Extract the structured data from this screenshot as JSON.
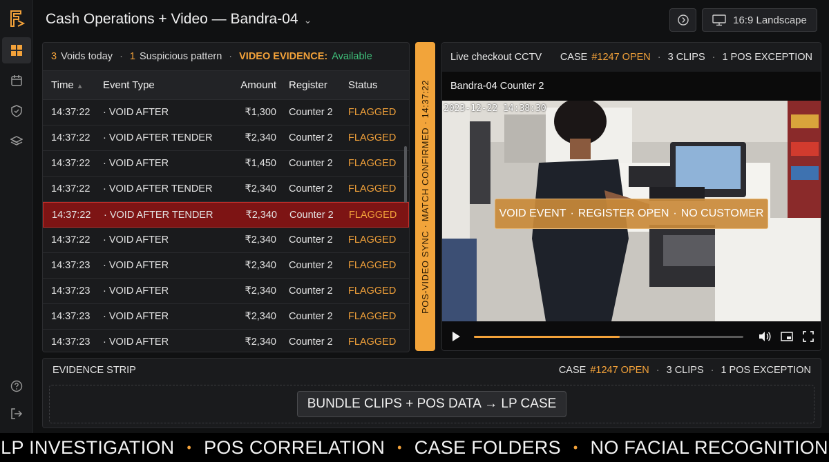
{
  "header": {
    "title": "Cash Operations + Video — Bandra-04",
    "layout_label": "16:9 Landscape"
  },
  "summary": {
    "voids_count": "3",
    "voids_label": "Voids today",
    "suspicious_count": "1",
    "suspicious_label": "Suspicious pattern",
    "video_label": "VIDEO EVIDENCE:",
    "video_status": "Available"
  },
  "table": {
    "columns": [
      "Time",
      "Event Type",
      "Amount",
      "Register",
      "Status"
    ],
    "rows": [
      {
        "time": "14:37:22",
        "type": "VOID AFTER",
        "amount": "₹1,300",
        "register": "Counter 2",
        "status": "FLAGGED"
      },
      {
        "time": "14:37:22",
        "type": "VOID AFTER TENDER",
        "amount": "₹2,340",
        "register": "Counter 2",
        "status": "FLAGGED"
      },
      {
        "time": "14:37:22",
        "type": "VOID AFTER",
        "amount": "₹1,450",
        "register": "Counter 2",
        "status": "FLAGGED"
      },
      {
        "time": "14:37:22",
        "type": "VOID AFTER TENDER",
        "amount": "₹2,340",
        "register": "Counter 2",
        "status": "FLAGGED"
      },
      {
        "time": "14:37:22",
        "type": "VOID AFTER TENDER",
        "amount": "₹2,340",
        "register": "Counter 2",
        "status": "FLAGGED",
        "selected": true
      },
      {
        "time": "14:37:22",
        "type": "VOID AFTER",
        "amount": "₹2,340",
        "register": "Counter 2",
        "status": "FLAGGED"
      },
      {
        "time": "14:37:23",
        "type": "VOID AFTER",
        "amount": "₹2,340",
        "register": "Counter 2",
        "status": "FLAGGED"
      },
      {
        "time": "14:37:23",
        "type": "VOID AFTER",
        "amount": "₹2,340",
        "register": "Counter 2",
        "status": "FLAGGED"
      },
      {
        "time": "14:37:23",
        "type": "VOID AFTER",
        "amount": "₹2,340",
        "register": "Counter 2",
        "status": "FLAGGED"
      },
      {
        "time": "14:37:23",
        "type": "VOID AFTER",
        "amount": "₹2,340",
        "register": "Counter 2",
        "status": "FLAGGED"
      }
    ]
  },
  "sync_bar": "POS-VIDEO SYNC · MATCH CONFIRMED · 14:37:22",
  "video": {
    "title": "Live checkout CCTV",
    "case_prefix": "CASE",
    "case_id": "#1247 OPEN",
    "clips": "3 CLIPS",
    "exceptions": "1 POS EXCEPTION",
    "camera_name": "Bandra-04 Counter 2",
    "timestamp": "2023-12-22 14:38:30",
    "overlay": [
      "VOID EVENT",
      "REGISTER OPEN",
      "NO CUSTOMER"
    ],
    "progress": 0.54
  },
  "evidence_strip": {
    "title": "EVIDENCE STRIP",
    "case_prefix": "CASE",
    "case_id": "#1247 OPEN",
    "clips": "3 CLIPS",
    "exceptions": "1 POS EXCEPTION",
    "bundle_button": "BUNDLE CLIPS + POS DATA → LP CASE"
  },
  "footer": [
    "LP INVESTIGATION",
    "POS CORRELATION",
    "CASE FOLDERS",
    "NO FACIAL RECOGNITION"
  ],
  "colors": {
    "accent": "#f3a23a",
    "flagged": "#f3a23a",
    "available": "#3fc07a",
    "selected_row": "#7d1414"
  }
}
